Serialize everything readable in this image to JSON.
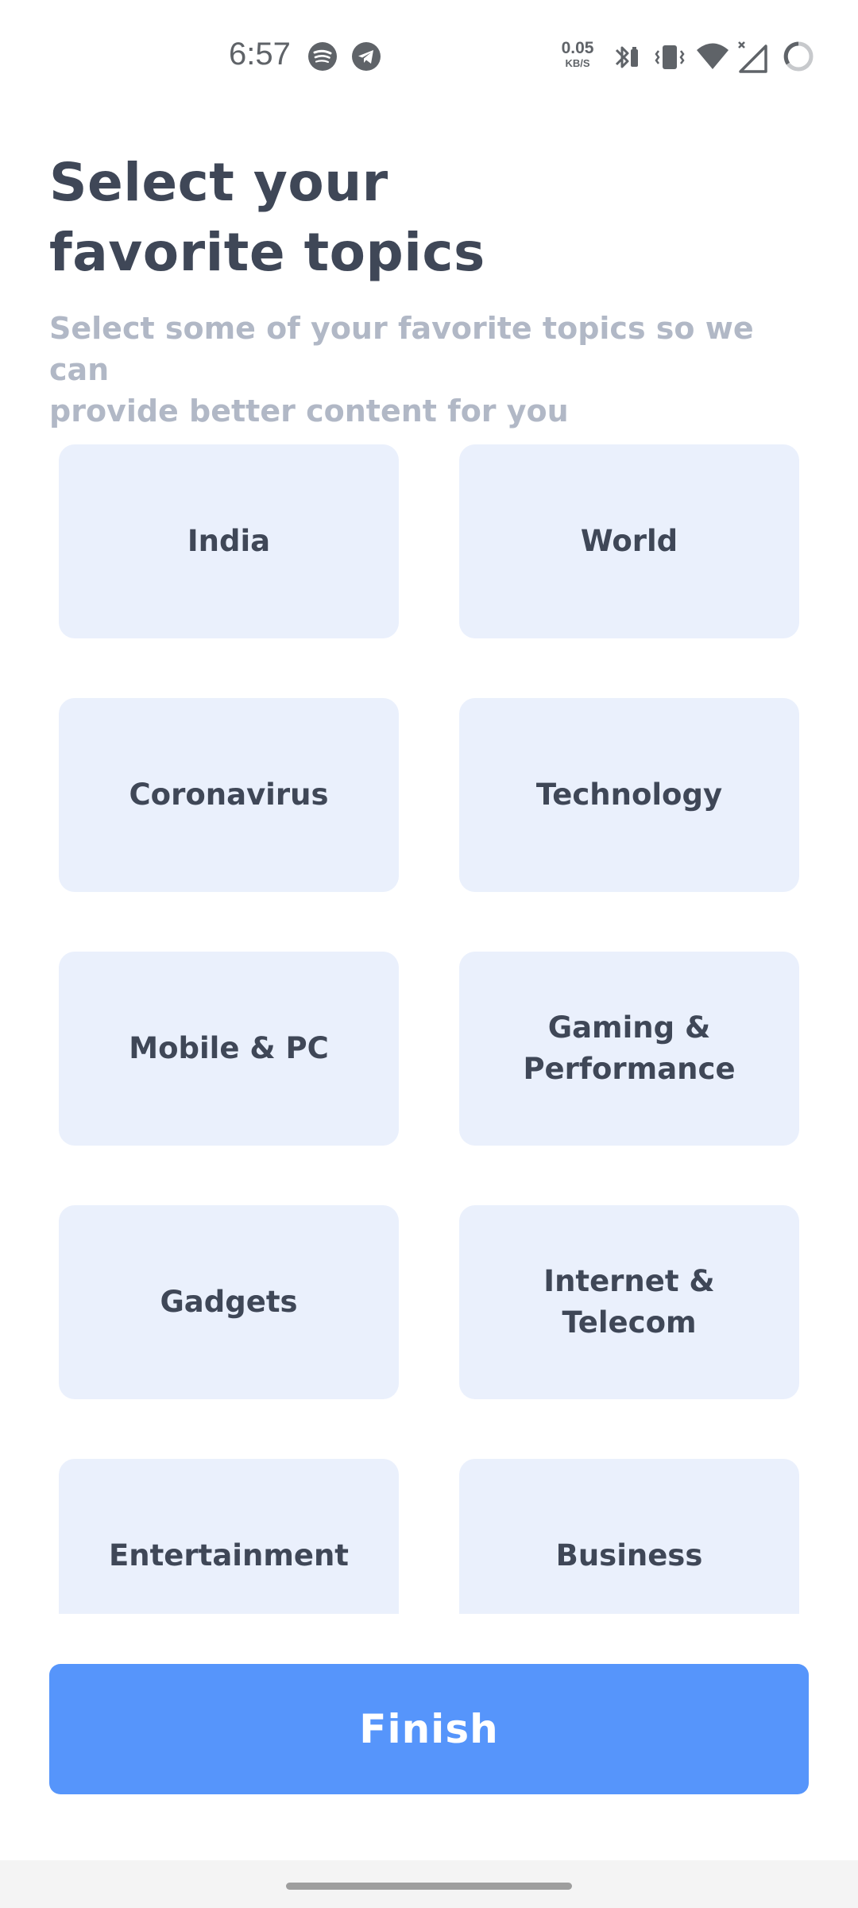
{
  "status_bar": {
    "time": "6:57",
    "net_speed_value": "0.05",
    "net_speed_unit": "KB/S",
    "icons": [
      "spotify-icon",
      "telegram-icon",
      "bluetooth-icon",
      "vibrate-icon",
      "wifi-icon",
      "cell-signal-icon",
      "battery-ring-icon"
    ]
  },
  "header": {
    "title_line1": "Select your",
    "title_line2": "favorite topics",
    "subtitle_line1": "Select some of your favorite topics so we can",
    "subtitle_line2": "provide better content for you"
  },
  "topics": [
    {
      "label": "India"
    },
    {
      "label": "World"
    },
    {
      "label": "Coronavirus"
    },
    {
      "label": "Technology"
    },
    {
      "label": "Mobile & PC"
    },
    {
      "label": "Gaming & Performance"
    },
    {
      "label": "Gadgets"
    },
    {
      "label": "Internet & Telecom"
    },
    {
      "label": "Entertainment"
    },
    {
      "label": "Business"
    }
  ],
  "finish_button": {
    "label": "Finish"
  },
  "colors": {
    "accent": "#5695fb",
    "card_bg": "#eaf0fc",
    "title_text": "#3f4757",
    "subtitle_text": "#b1b8c6"
  }
}
